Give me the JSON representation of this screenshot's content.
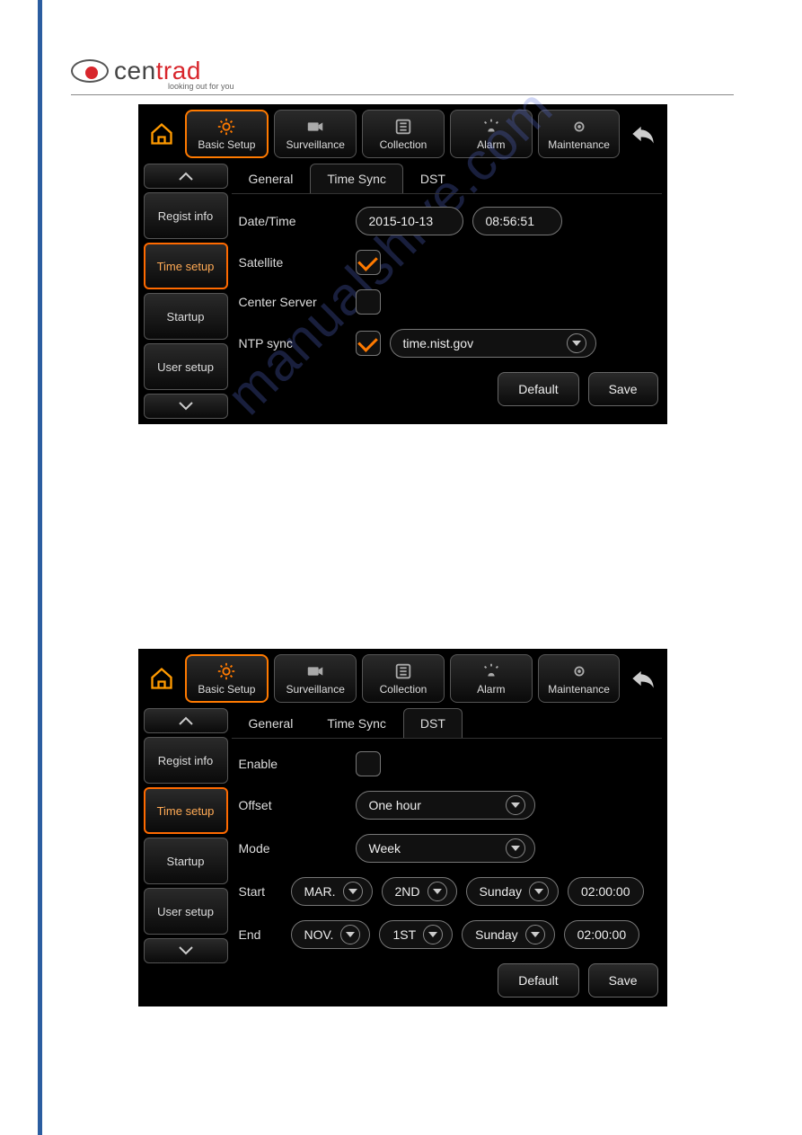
{
  "brand": {
    "name_prefix": "cen",
    "name_suffix": "trad",
    "tagline": "looking out for you"
  },
  "watermark": "manualshive.com",
  "nav": {
    "items": [
      {
        "key": "basic-setup",
        "label": "Basic Setup"
      },
      {
        "key": "surveillance",
        "label": "Surveillance"
      },
      {
        "key": "collection",
        "label": "Collection"
      },
      {
        "key": "alarm",
        "label": "Alarm"
      },
      {
        "key": "maintenance",
        "label": "Maintenance"
      }
    ],
    "active": "basic-setup"
  },
  "sidebar": {
    "items": [
      {
        "key": "regist-info",
        "label": "Regist info"
      },
      {
        "key": "time-setup",
        "label": "Time setup"
      },
      {
        "key": "startup",
        "label": "Startup"
      },
      {
        "key": "user-setup",
        "label": "User setup"
      }
    ],
    "active": "time-setup"
  },
  "tabs": {
    "items": [
      "General",
      "Time Sync",
      "DST"
    ]
  },
  "buttons": {
    "default": "Default",
    "save": "Save"
  },
  "panel_timesync": {
    "active_tab": "Time Sync",
    "labels": {
      "datetime": "Date/Time",
      "satellite": "Satellite",
      "center_server": "Center Server",
      "ntp_sync": "NTP sync"
    },
    "values": {
      "date": "2015-10-13",
      "time": "08:56:51",
      "satellite_checked": true,
      "center_server_checked": false,
      "ntp_sync_checked": true,
      "ntp_server": "time.nist.gov"
    }
  },
  "panel_dst": {
    "active_tab": "DST",
    "labels": {
      "enable": "Enable",
      "offset": "Offset",
      "mode": "Mode",
      "start": "Start",
      "end": "End"
    },
    "values": {
      "enable_checked": false,
      "offset": "One hour",
      "mode": "Week",
      "start": {
        "month": "MAR.",
        "ordinal": "2ND",
        "day": "Sunday",
        "time": "02:00:00"
      },
      "end": {
        "month": "NOV.",
        "ordinal": "1ST",
        "day": "Sunday",
        "time": "02:00:00"
      }
    }
  }
}
